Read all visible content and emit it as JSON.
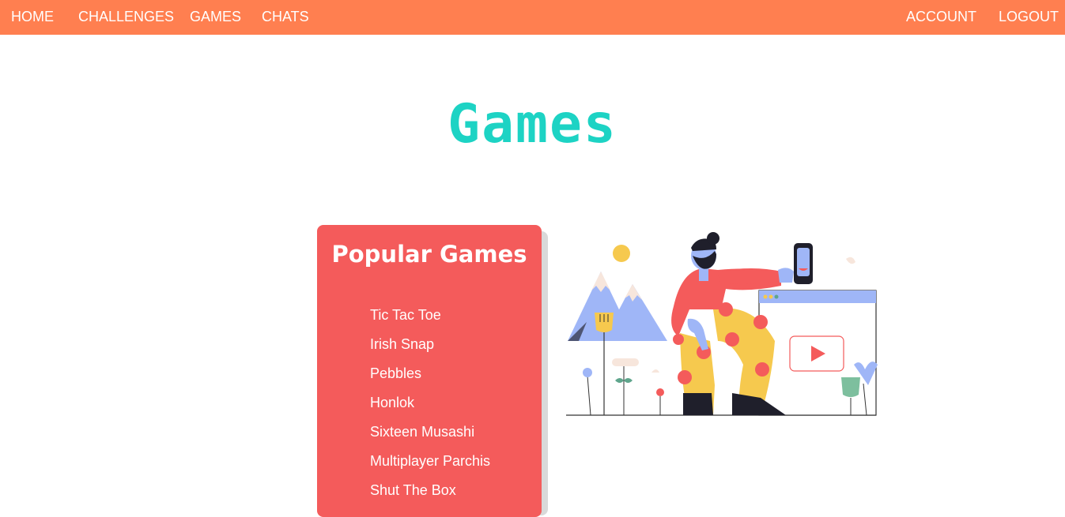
{
  "nav": {
    "home": "HOME",
    "challenges": "CHALLENGES",
    "games": "GAMES",
    "chats": "CHATS",
    "account": "ACCOUNT",
    "logout": "LOGOUT"
  },
  "page": {
    "title": "Games"
  },
  "popular": {
    "title": "Popular Games",
    "games": [
      "Tic Tac Toe",
      "Irish Snap",
      "Pebbles",
      "Honlok",
      "Sixteen Musashi",
      "Multiplayer Parchis",
      "Shut The Box"
    ]
  },
  "colors": {
    "navbar": "#ff7f50",
    "title": "#1dd3c4",
    "card": "#f45b5b"
  }
}
